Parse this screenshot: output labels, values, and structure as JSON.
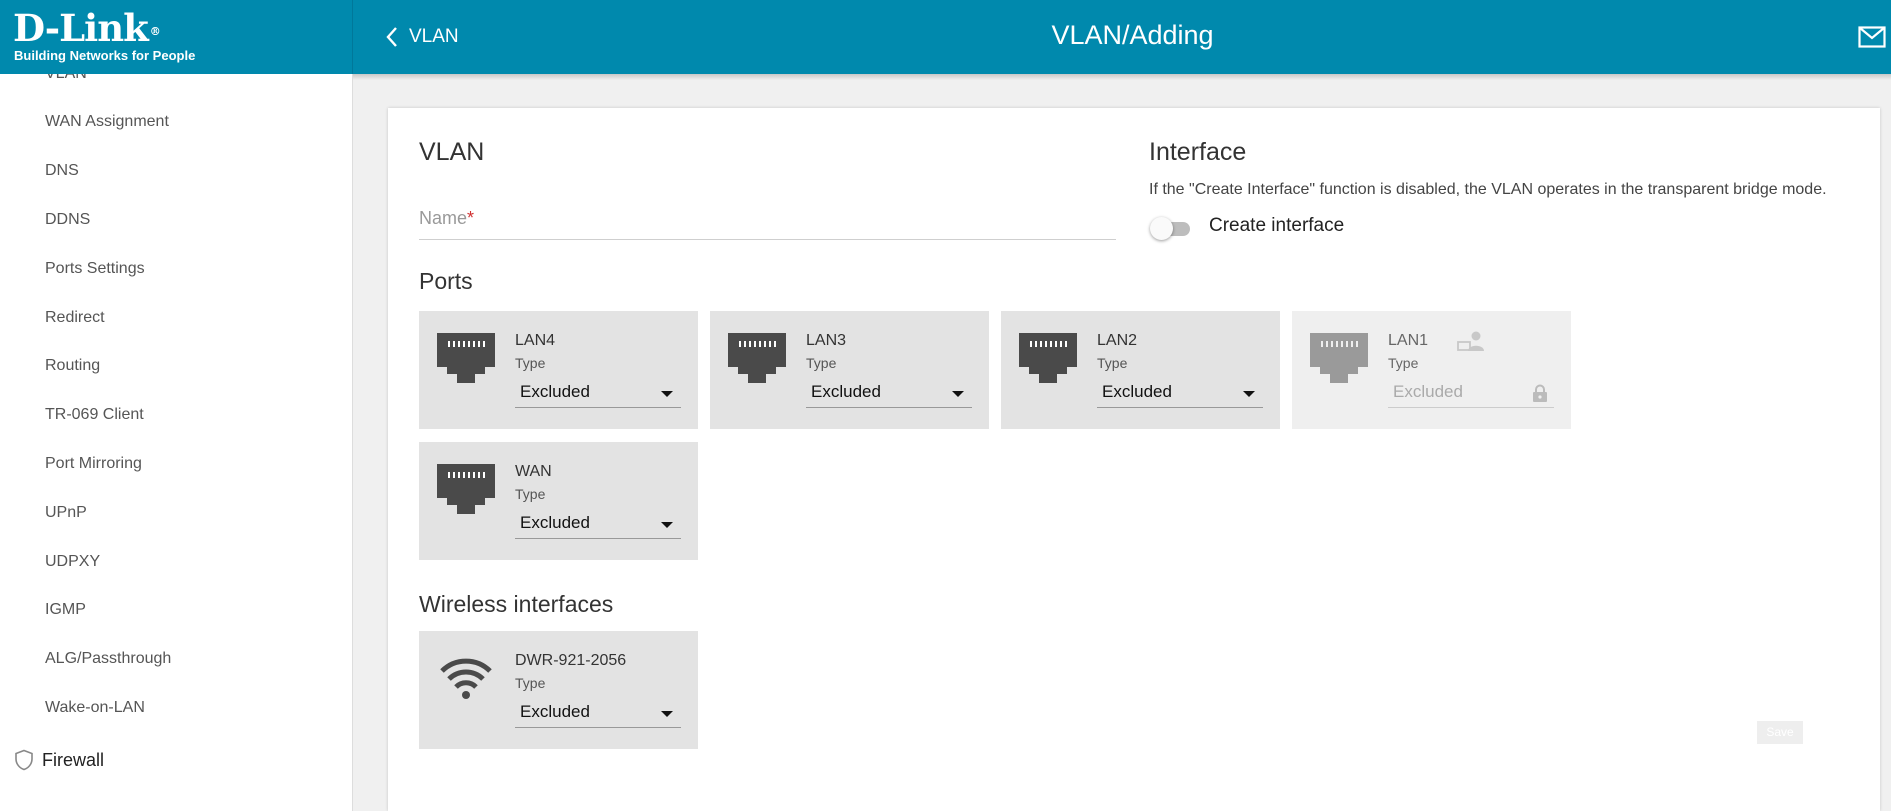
{
  "brand": {
    "name": "D-Link",
    "registered": "®",
    "tagline": "Building Networks for People"
  },
  "header": {
    "back_label": "VLAN",
    "title": "VLAN/Adding"
  },
  "sidebar": {
    "cut_item": "VLAN",
    "items": [
      "WAN Assignment",
      "DNS",
      "DDNS",
      "Ports Settings",
      "Redirect",
      "Routing",
      "TR-069 Client",
      "Port Mirroring",
      "UPnP",
      "UDPXY",
      "IGMP",
      "ALG/Passthrough",
      "Wake-on-LAN"
    ],
    "section": "Firewall"
  },
  "vlan": {
    "heading": "VLAN",
    "name_placeholder": "Name",
    "name_required": "*",
    "name_value": ""
  },
  "interface": {
    "heading": "Interface",
    "description": "If the \"Create Interface\" function is disabled, the VLAN operates in the transparent bridge mode.",
    "toggle_label": "Create interface",
    "toggle_on": false
  },
  "ports": {
    "heading": "Ports",
    "type_label": "Type",
    "items": [
      {
        "name": "LAN4",
        "value": "Excluded",
        "disabled": false
      },
      {
        "name": "LAN3",
        "value": "Excluded",
        "disabled": false
      },
      {
        "name": "LAN2",
        "value": "Excluded",
        "disabled": false
      },
      {
        "name": "LAN1",
        "value": "Excluded",
        "disabled": true
      },
      {
        "name": "WAN",
        "value": "Excluded",
        "disabled": false
      }
    ]
  },
  "wireless": {
    "heading": "Wireless interfaces",
    "items": [
      {
        "name": "DWR-921-2056",
        "value": "Excluded"
      }
    ]
  },
  "actions": {
    "save_label": "Save"
  },
  "colors": {
    "header": "#0089ad",
    "port_tile": "#e3e3e3",
    "port_disabled": "#efefef",
    "icon": "#4a4a4a"
  }
}
